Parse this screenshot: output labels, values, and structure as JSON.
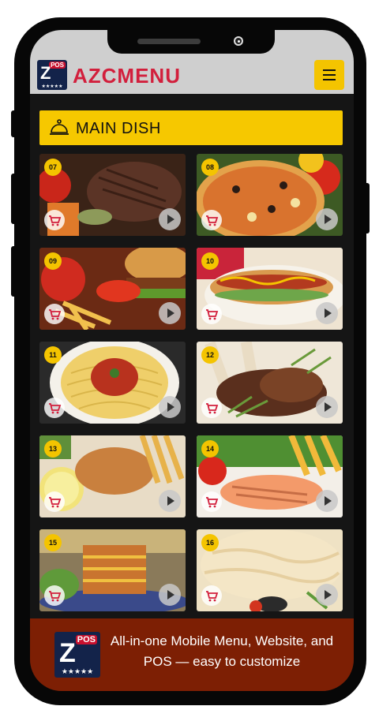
{
  "app": {
    "brand": "AZCMENU",
    "logo_badge": "POS",
    "logo_letter": "Z",
    "logo_stars": "★★★★★"
  },
  "header": {
    "menu_icon": "hamburger-icon"
  },
  "category": {
    "title": "MAIN DISH",
    "icon": "serving-cloche-icon"
  },
  "items": [
    {
      "number": "07",
      "dish": "steak"
    },
    {
      "number": "08",
      "dish": "pizza"
    },
    {
      "number": "09",
      "dish": "burger"
    },
    {
      "number": "10",
      "dish": "hot dog"
    },
    {
      "number": "11",
      "dish": "spaghetti"
    },
    {
      "number": "12",
      "dish": "lamb chops"
    },
    {
      "number": "13",
      "dish": "fish and chips"
    },
    {
      "number": "14",
      "dish": "grilled salmon"
    },
    {
      "number": "15",
      "dish": "lasagna"
    },
    {
      "number": "16",
      "dish": "seafood dish"
    }
  ],
  "footer": {
    "text": "All-in-one Mobile Menu, Website, and POS — easy to customize"
  },
  "colors": {
    "accent": "#f4c400",
    "brand_red": "#d21f3c",
    "footer_bg": "#7d1f04"
  }
}
